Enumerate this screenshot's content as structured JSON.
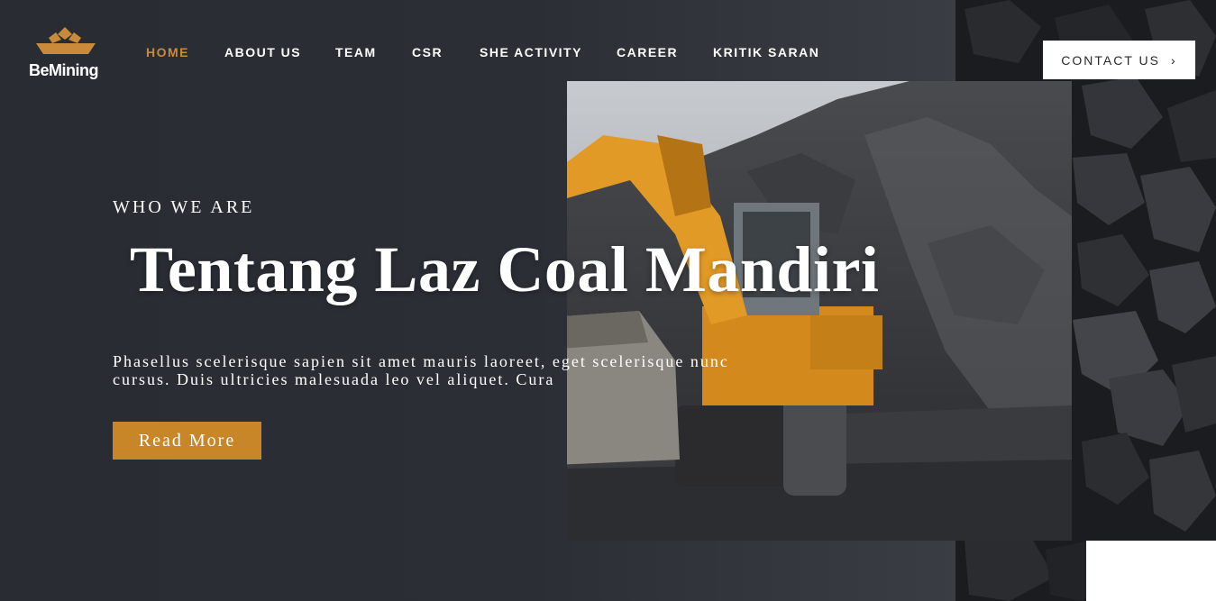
{
  "brand": {
    "name": "BeMining",
    "accent": "#c98a3a"
  },
  "nav": {
    "items": [
      {
        "label": "HOME",
        "active": true
      },
      {
        "label": "ABOUT US",
        "active": false
      },
      {
        "label": "TEAM",
        "active": false
      },
      {
        "label": "CSR",
        "active": false
      },
      {
        "label": "SHE ACTIVITY",
        "active": false
      },
      {
        "label": "CAREER",
        "active": false
      },
      {
        "label": "KRITIK SARAN",
        "active": false
      }
    ],
    "contact_label": "CONTACT US",
    "contact_icon": "chevron-right-icon"
  },
  "hero": {
    "kicker": "WHO WE ARE",
    "title": "Tentang Laz Coal Mandiri",
    "description": "Phasellus scelerisque sapien sit amet mauris laoreet, eget scelerisque nunc cursus. Duis ultricies malesuada leo vel aliquet. Cura",
    "button_label": "Read More",
    "button_color": "#c98628",
    "image": "excavator-in-coal-quarry"
  },
  "colors": {
    "background": "#292c33",
    "text": "#ffffff",
    "coal_strip": "#1c1d20"
  }
}
